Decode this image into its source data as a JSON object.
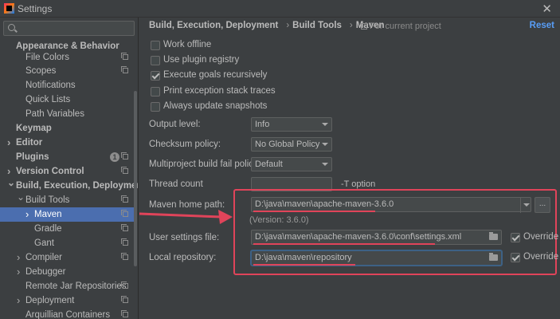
{
  "window": {
    "title": "Settings"
  },
  "sidebar": {
    "search": {
      "placeholder": ""
    },
    "items": [
      {
        "label": "Appearance & Behavior",
        "indent": 1,
        "bold": true,
        "arrow": ""
      },
      {
        "label": "File Colors",
        "indent": 2,
        "bold": false,
        "arrow": "",
        "icon": true
      },
      {
        "label": "Scopes",
        "indent": 2,
        "bold": false,
        "arrow": "",
        "icon": true
      },
      {
        "label": "Notifications",
        "indent": 2,
        "bold": false,
        "arrow": ""
      },
      {
        "label": "Quick Lists",
        "indent": 2,
        "bold": false,
        "arrow": ""
      },
      {
        "label": "Path Variables",
        "indent": 2,
        "bold": false,
        "arrow": ""
      },
      {
        "label": "Keymap",
        "indent": 1,
        "bold": true,
        "arrow": ""
      },
      {
        "label": "Editor",
        "indent": 1,
        "bold": true,
        "arrow": ">"
      },
      {
        "label": "Plugins",
        "indent": 1,
        "bold": true,
        "arrow": "",
        "badge": "1",
        "icon": true
      },
      {
        "label": "Version Control",
        "indent": 1,
        "bold": true,
        "arrow": ">",
        "icon": true
      },
      {
        "label": "Build, Execution, Deployment",
        "indent": 1,
        "bold": true,
        "arrow": "v"
      },
      {
        "label": "Build Tools",
        "indent": 2,
        "bold": false,
        "arrow": "v",
        "icon": true
      },
      {
        "label": "Maven",
        "indent": 3,
        "bold": false,
        "arrow": ">",
        "icon": true,
        "selected": true
      },
      {
        "label": "Gradle",
        "indent": 3,
        "bold": false,
        "arrow": "",
        "icon": true
      },
      {
        "label": "Gant",
        "indent": 3,
        "bold": false,
        "arrow": "",
        "icon": true
      },
      {
        "label": "Compiler",
        "indent": 2,
        "bold": false,
        "arrow": ">",
        "icon": true
      },
      {
        "label": "Debugger",
        "indent": 2,
        "bold": false,
        "arrow": ">"
      },
      {
        "label": "Remote Jar Repositories",
        "indent": 2,
        "bold": false,
        "arrow": "",
        "icon": true
      },
      {
        "label": "Deployment",
        "indent": 2,
        "bold": false,
        "arrow": ">",
        "icon": true
      },
      {
        "label": "Arquillian Containers",
        "indent": 2,
        "bold": false,
        "arrow": "",
        "icon": true
      }
    ]
  },
  "breadcrumb": {
    "items": [
      "Build, Execution, Deployment",
      "Build Tools",
      "Maven"
    ],
    "scope": "For current project",
    "reset": "Reset"
  },
  "checkboxes": [
    {
      "label": "Work offline",
      "checked": false
    },
    {
      "label": "Use plugin registry",
      "checked": false
    },
    {
      "label": "Execute goals recursively",
      "checked": true
    },
    {
      "label": "Print exception stack traces",
      "checked": false
    },
    {
      "label": "Always update snapshots",
      "checked": false
    }
  ],
  "fields": {
    "output_level": {
      "label": "Output level:",
      "value": "Info"
    },
    "checksum_policy": {
      "label": "Checksum policy:",
      "value": "No Global Policy"
    },
    "multiproject": {
      "label": "Multiproject build fail policy:",
      "value": "Default"
    },
    "thread_count": {
      "label": "Thread count",
      "value": "",
      "suffix": "-T option"
    },
    "maven_home": {
      "label": "Maven home path:",
      "value": "D:\\java\\maven\\apache-maven-3.6.0",
      "version": "(Version: 3.6.0)",
      "browse": "..."
    },
    "user_settings": {
      "label": "User settings file:",
      "value": "D:\\java\\maven\\apache-maven-3.6.0\\conf\\settings.xml",
      "override_label": "Override",
      "override_checked": true
    },
    "local_repo": {
      "label": "Local repository:",
      "value": "D:\\java\\maven\\repository",
      "override_label": "Override",
      "override_checked": true
    }
  },
  "colors": {
    "accent": "#4b6eaf",
    "link": "#589df6",
    "annotation": "#e0445a"
  }
}
